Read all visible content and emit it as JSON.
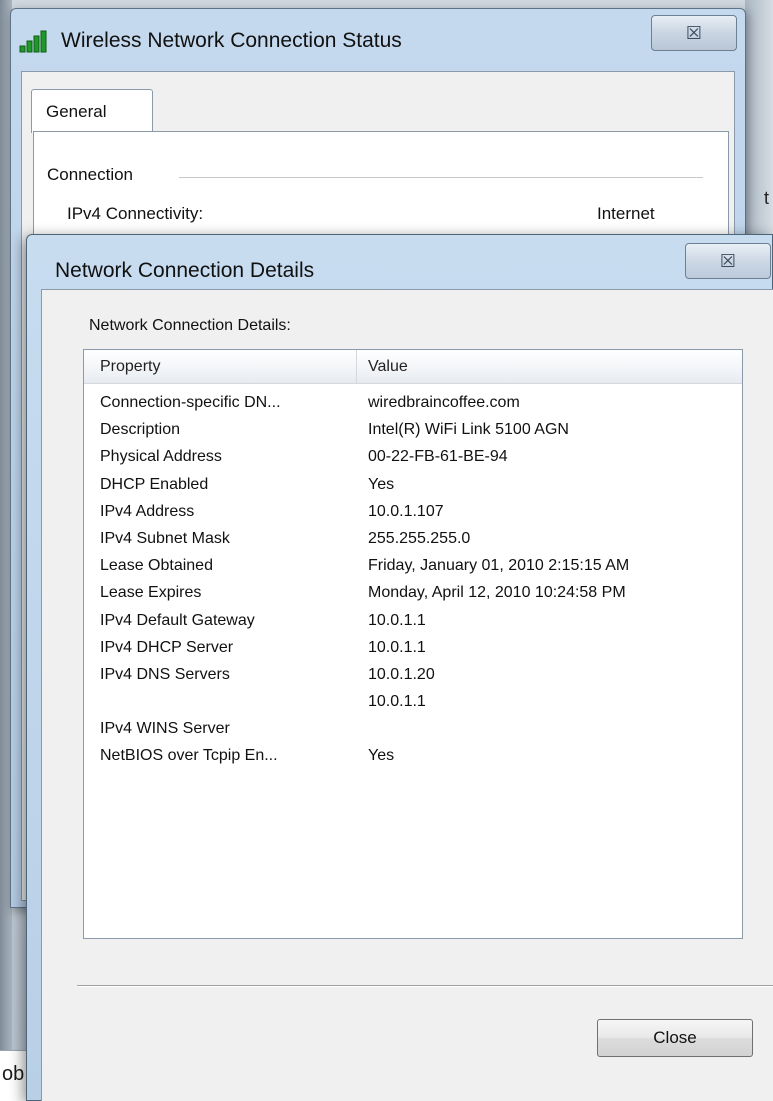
{
  "background": {
    "bottom_fragment_text": "ob",
    "right_fragment_text": "t"
  },
  "status_window": {
    "title": "Wireless Network Connection Status",
    "close_glyph": "☒",
    "tab_label": "General",
    "group_label": "Connection",
    "ipv4_connectivity_label": "IPv4 Connectivity:",
    "ipv4_connectivity_value": "Internet",
    "icon": "wireless-signal-icon"
  },
  "details_window": {
    "title": "Network Connection Details",
    "close_glyph": "☒",
    "caption": "Network Connection Details:",
    "columns": {
      "property": "Property",
      "value": "Value"
    },
    "rows": [
      {
        "property": "Connection-specific DN...",
        "value": "wiredbraincoffee.com"
      },
      {
        "property": "Description",
        "value": "Intel(R) WiFi Link 5100 AGN"
      },
      {
        "property": "Physical Address",
        "value": "00-22-FB-61-BE-94"
      },
      {
        "property": "DHCP Enabled",
        "value": "Yes"
      },
      {
        "property": "IPv4 Address",
        "value": "10.0.1.107"
      },
      {
        "property": "IPv4 Subnet Mask",
        "value": "255.255.255.0"
      },
      {
        "property": "Lease Obtained",
        "value": "Friday, January 01, 2010 2:15:15 AM"
      },
      {
        "property": "Lease Expires",
        "value": "Monday, April 12, 2010 10:24:58 PM"
      },
      {
        "property": "IPv4 Default Gateway",
        "value": "10.0.1.1"
      },
      {
        "property": "IPv4 DHCP Server",
        "value": "10.0.1.1"
      },
      {
        "property": "IPv4 DNS Servers",
        "value": "10.0.1.20"
      },
      {
        "property": "",
        "value": "10.0.1.1"
      },
      {
        "property": "IPv4 WINS Server",
        "value": ""
      },
      {
        "property": "NetBIOS over Tcpip En...",
        "value": "Yes"
      }
    ],
    "close_button_label": "Close"
  },
  "colors": {
    "title_bar": "#c5d9ee",
    "signal_green": "#1f9a2a",
    "window_body": "#f0f0f0"
  }
}
